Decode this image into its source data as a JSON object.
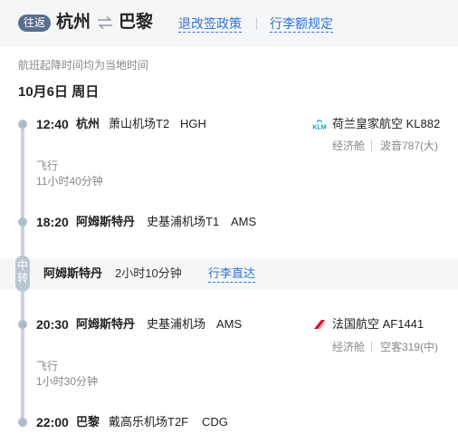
{
  "header": {
    "trip_type": "往返",
    "from_city": "杭州",
    "to_city": "巴黎",
    "refund_policy": "退改签政策",
    "baggage_rules": "行李额规定"
  },
  "notice": "航班起降时间均为当地时间",
  "date": "10月6日 周日",
  "segments": [
    {
      "dep_time": "12:40",
      "dep_city": "杭州",
      "dep_airport": "萧山机场T2",
      "dep_code": "HGH",
      "airline": "荷兰皇家航空 KL882",
      "cabin": "经济舱",
      "aircraft": "波音787(大)",
      "flying_label": "飞行",
      "duration": "11小时40分钟",
      "arr_time": "18:20",
      "arr_city": "阿姆斯特丹",
      "arr_airport": "史基浦机场T1",
      "arr_code": "AMS"
    },
    {
      "dep_time": "20:30",
      "dep_city": "阿姆斯特丹",
      "dep_airport": "史基浦机场",
      "dep_code": "AMS",
      "airline": "法国航空 AF1441",
      "cabin": "经济舱",
      "aircraft": "空客319(中)",
      "flying_label": "飞行",
      "duration": "1小时30分钟",
      "arr_time": "22:00",
      "arr_city": "巴黎",
      "arr_airport": "戴高乐机场T2F",
      "arr_code": "CDG"
    }
  ],
  "transfer": {
    "pill": "中转",
    "city": "阿姆斯特丹",
    "duration": "2小时10分钟",
    "through_baggage": "行李直达"
  },
  "colors": {
    "link": "#2f72d6",
    "badge": "#5a6f8d",
    "klm_blue": "#00a1de",
    "af_red": "#e4002b"
  },
  "icons": {
    "swap": "swap-arrows-icon",
    "klm": "klm-logo-icon",
    "air_france": "air-france-logo-icon"
  }
}
